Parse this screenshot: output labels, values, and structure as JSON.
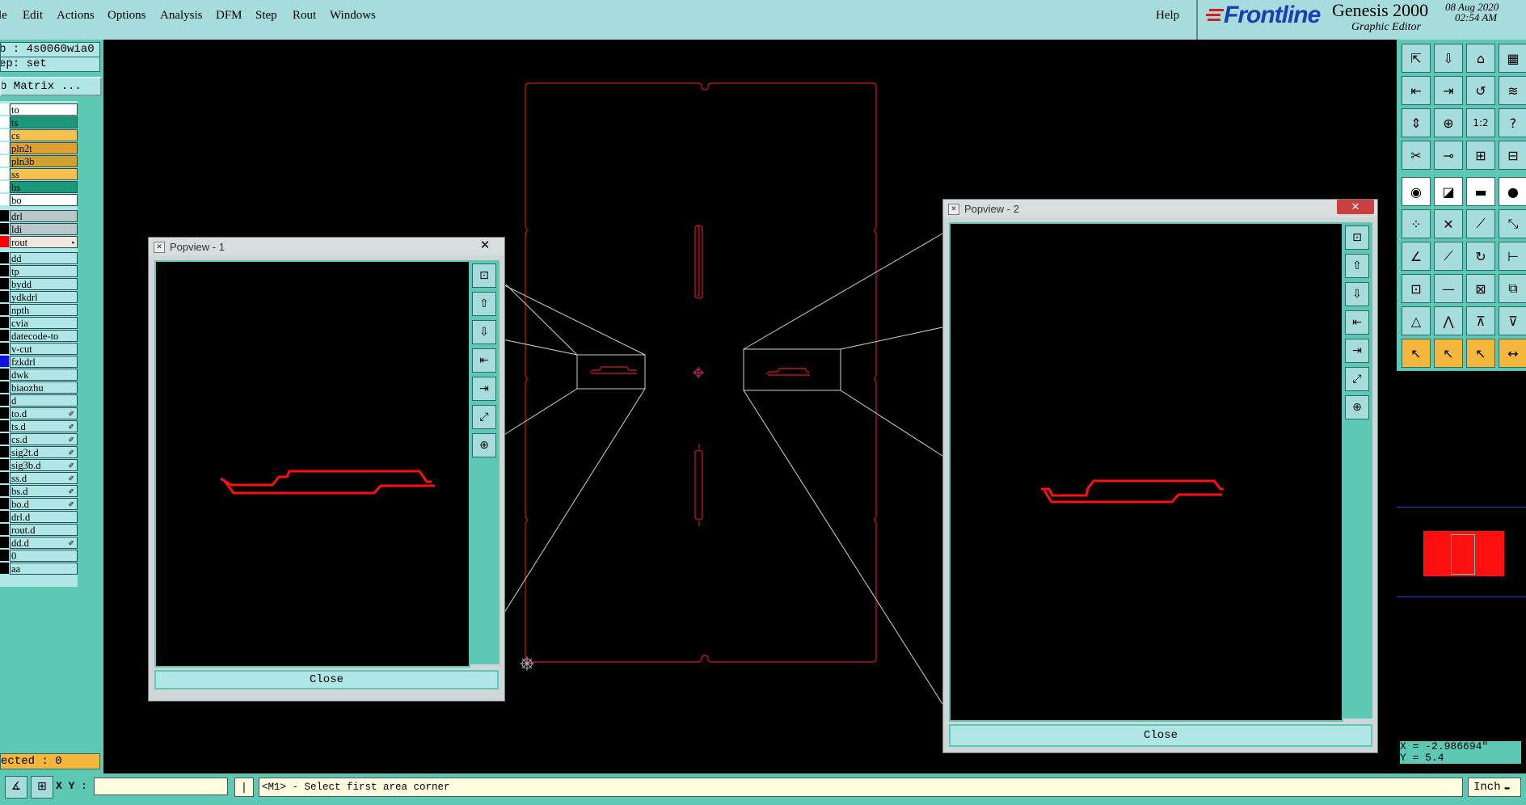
{
  "menu": [
    "le",
    "Edit",
    "Actions",
    "Options",
    "Analysis",
    "DFM",
    "Step",
    "Rout",
    "Windows"
  ],
  "help": "Help",
  "brand": {
    "logo": "Frontline",
    "product": "Genesis 2000",
    "subtitle": "Graphic Editor",
    "date": "08 Aug 2020",
    "time": "02:54 AM"
  },
  "info": {
    "job": "b : 4s0060wia0",
    "step": "ep: set",
    "matrix": "b Matrix ...",
    "selected": "ected : 0"
  },
  "layers": [
    {
      "name": "to",
      "color": "#ffffff",
      "swatch": "#ffffff"
    },
    {
      "name": "ts",
      "color": "#1a9a7a",
      "swatch": "#ffffff"
    },
    {
      "name": "cs",
      "color": "#f5c050",
      "swatch": "#ffffff"
    },
    {
      "name": "pln2t",
      "color": "#e0a030",
      "swatch": "#ffffff"
    },
    {
      "name": "pln3b",
      "color": "#d0a030",
      "swatch": "#ffffff"
    },
    {
      "name": "ss",
      "color": "#f5c050",
      "swatch": "#ffffff"
    },
    {
      "name": "bs",
      "color": "#1a9a7a",
      "swatch": "#ffffff"
    },
    {
      "name": "bo",
      "color": "#ffffff",
      "swatch": "#ffffff"
    },
    {
      "name": "drl",
      "color": "#b8c8c8",
      "swatch": "#000000"
    },
    {
      "name": "ldi",
      "color": "#b8c8c8",
      "swatch": "#000000"
    },
    {
      "name": "rout",
      "color": "#f0e8e0",
      "swatch": "#ff0000",
      "icon": "▪"
    },
    {
      "name": "dd",
      "color": "#b0e6e6",
      "swatch": "#000000"
    },
    {
      "name": "tp",
      "color": "#b0e6e6",
      "swatch": "#000000"
    },
    {
      "name": "bydd",
      "color": "#b0e6e6",
      "swatch": "#000000"
    },
    {
      "name": "ydkdrl",
      "color": "#b0e6e6",
      "swatch": "#000000"
    },
    {
      "name": "npth",
      "color": "#b0e6e6",
      "swatch": "#000000"
    },
    {
      "name": "cvia",
      "color": "#b0e6e6",
      "swatch": "#000000"
    },
    {
      "name": "datecode-to",
      "color": "#b0e6e6",
      "swatch": "#000000"
    },
    {
      "name": "v-cut",
      "color": "#b0e6e6",
      "swatch": "#000000"
    },
    {
      "name": "fzkdrl",
      "color": "#b0e6e6",
      "swatch": "#1010e0"
    },
    {
      "name": "dwk",
      "color": "#b0e6e6",
      "swatch": "#000000"
    },
    {
      "name": "biaozhu",
      "color": "#b0e6e6",
      "swatch": "#000000"
    },
    {
      "name": "d",
      "color": "#b0e6e6",
      "swatch": "#000000"
    },
    {
      "name": "to.d",
      "color": "#b0e6e6",
      "swatch": "#000000",
      "icon": "✐"
    },
    {
      "name": "ts.d",
      "color": "#b0e6e6",
      "swatch": "#000000",
      "icon": "✐"
    },
    {
      "name": "cs.d",
      "color": "#b0e6e6",
      "swatch": "#000000",
      "icon": "✐"
    },
    {
      "name": "sig2t.d",
      "color": "#b0e6e6",
      "swatch": "#000000",
      "icon": "✐"
    },
    {
      "name": "sig3b.d",
      "color": "#b0e6e6",
      "swatch": "#000000",
      "icon": "✐"
    },
    {
      "name": "ss.d",
      "color": "#b0e6e6",
      "swatch": "#000000",
      "icon": "✐"
    },
    {
      "name": "bs.d",
      "color": "#b0e6e6",
      "swatch": "#000000",
      "icon": "✐"
    },
    {
      "name": "bo.d",
      "color": "#b0e6e6",
      "swatch": "#000000",
      "icon": "✐"
    },
    {
      "name": "drl.d",
      "color": "#b0e6e6",
      "swatch": "#000000"
    },
    {
      "name": "rout.d",
      "color": "#b0e6e6",
      "swatch": "#000000"
    },
    {
      "name": "dd.d",
      "color": "#b0e6e6",
      "swatch": "#000000",
      "icon": "✐"
    },
    {
      "name": "0",
      "color": "#b0e6e6",
      "swatch": "#000000"
    },
    {
      "name": "aa",
      "color": "#b0e6e6",
      "swatch": "#000000"
    }
  ],
  "popview1": {
    "title": "Popview - 1",
    "close": "Close"
  },
  "popview2": {
    "title": "Popview - 2",
    "close": "Close"
  },
  "coords": {
    "x": "X = -2.986694\"",
    "y": "Y = 5.4"
  },
  "status": {
    "xy_label": "X Y :",
    "xy_value": "",
    "message": "<M1> - Select first area corner",
    "units": "Inch"
  },
  "toolbar_icons": [
    [
      "⇱",
      "⇩",
      "⌂",
      "▦"
    ],
    [
      "⇤",
      "⇥",
      "↺",
      "≋"
    ],
    [
      "⇕",
      "⊕",
      "1:2",
      "?"
    ],
    [
      "✂",
      "⊸",
      "⊞",
      "⊟"
    ],
    [
      "◉",
      "◪",
      "▬",
      "●"
    ],
    [
      "⁘",
      "✕",
      "⟋",
      "⤡"
    ],
    [
      "∠",
      "⟋",
      "↻",
      "⊢"
    ],
    [
      "⊡",
      "—",
      "⊠",
      "⧉"
    ],
    [
      "△",
      "⋀",
      "⊼",
      "⊽"
    ],
    [
      "↖",
      "↖",
      "↖",
      "↔"
    ]
  ],
  "colors": {
    "profile": "#b01818",
    "outline": "#ff1010",
    "accent": "#5dc8b4"
  }
}
